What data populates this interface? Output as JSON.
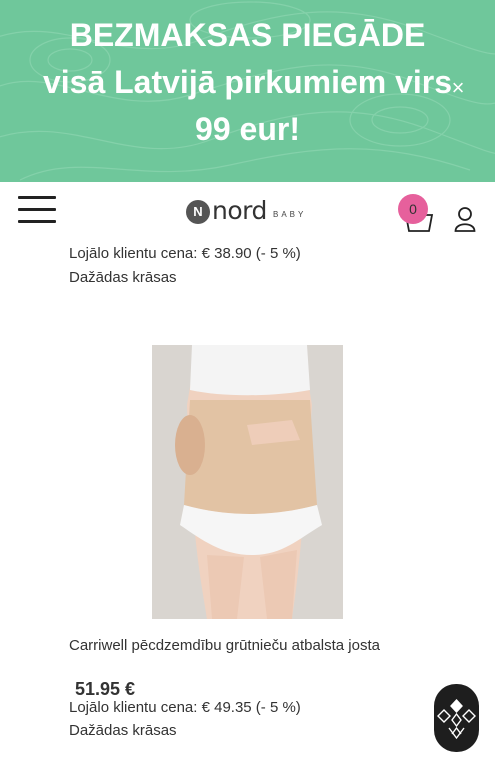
{
  "banner": {
    "lines": [
      "BEZMAKSAS PIEGĀDE",
      "visā Latvijā pirkumiem virs",
      "99 eur!"
    ],
    "close_icon": "close-icon"
  },
  "header": {
    "logo": {
      "word": "nord",
      "sub": "BABY",
      "mark": "N"
    },
    "cart_count": "0"
  },
  "products": [
    {
      "loyalty_price": "Lojālo klientu cena: € 38.90 (- 5 %)",
      "colors": "Dažādas krāsas"
    },
    {
      "name": "Carriwell pēcdzemdību grūtnieču atbalsta josta",
      "price": "51.95 €",
      "loyalty_price": "Lojālo klientu cena: € 49.35 (- 5 %)",
      "colors": "Dažādas krāsas"
    }
  ],
  "colors": {
    "banner": "#6fc79b",
    "badge": "#e6609c",
    "chat": "#1e1e1e"
  }
}
